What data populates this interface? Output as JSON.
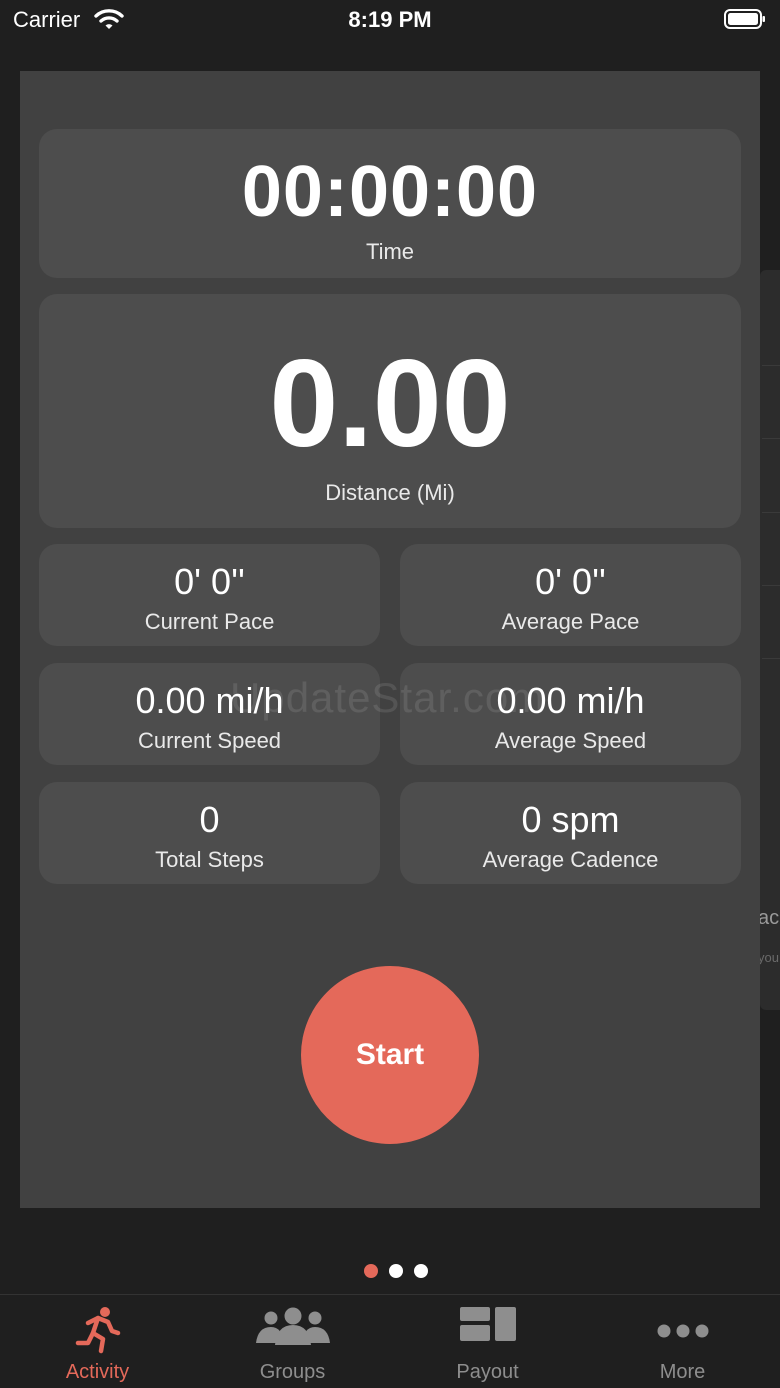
{
  "status_bar": {
    "carrier": "Carrier",
    "time": "8:19 PM"
  },
  "stats": {
    "time": {
      "value": "00:00:00",
      "label": "Time"
    },
    "distance": {
      "value": "0.00",
      "label": "Distance (Mi)"
    },
    "current_pace": {
      "value": "0' 0''",
      "label": "Current Pace"
    },
    "average_pace": {
      "value": "0' 0''",
      "label": "Average Pace"
    },
    "current_speed": {
      "value": "0.00 mi/h",
      "label": "Current Speed"
    },
    "average_speed": {
      "value": "0.00 mi/h",
      "label": "Average Speed"
    },
    "total_steps": {
      "value": "0",
      "label": "Total Steps"
    },
    "average_cadence": {
      "value": "0 spm",
      "label": "Average Cadence"
    }
  },
  "watermark": "UpdateStar.com",
  "peek": {
    "text": "ac",
    "small": "you"
  },
  "start_button": {
    "label": "Start"
  },
  "page_indicator": {
    "count": 3,
    "active": 1
  },
  "tab_bar": {
    "items": [
      {
        "label": "Activity",
        "icon": "running-icon",
        "active": true
      },
      {
        "label": "Groups",
        "icon": "groups-icon",
        "active": false
      },
      {
        "label": "Payout",
        "icon": "payout-icon",
        "active": false
      },
      {
        "label": "More",
        "icon": "more-icon",
        "active": false
      }
    ]
  },
  "colors": {
    "accent": "#e4695a",
    "card": "#414141",
    "tile": "#4d4d4d",
    "background": "#1f1f1f"
  }
}
